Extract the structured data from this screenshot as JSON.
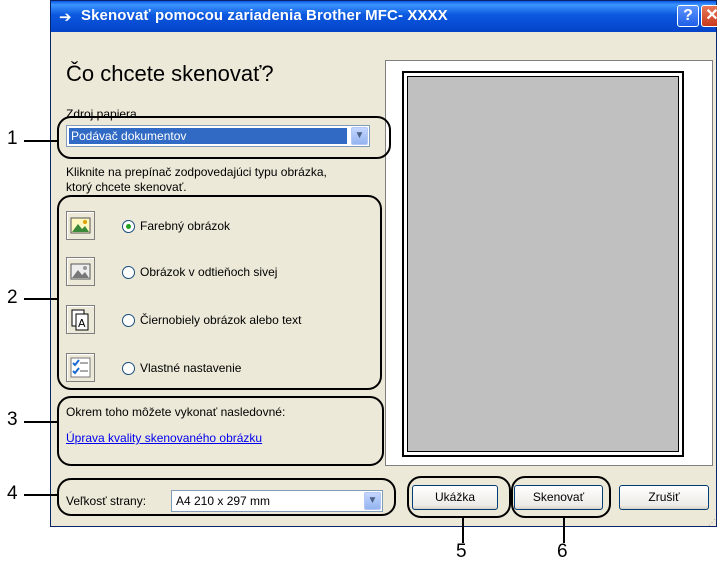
{
  "window": {
    "title": "Skenovať pomocou zariadenia Brother MFC- XXXX",
    "help_label": "?",
    "close_label": "✕"
  },
  "heading": "Čo chcete skenovať?",
  "paper_source": {
    "label": "Zdroj papiera",
    "value": "Podávač dokumentov"
  },
  "instructions": {
    "line1": "Kliknite na prepínač zodpovedajúci typu obrázka,",
    "line2": "ktorý chcete skenovať."
  },
  "scan_types": [
    {
      "label": "Farebný obrázok",
      "icon": "color-photo-icon",
      "selected": true
    },
    {
      "label": "Obrázok v odtieňoch sivej",
      "icon": "grayscale-photo-icon",
      "selected": false
    },
    {
      "label": "Čiernobiely obrázok alebo text",
      "icon": "bw-text-icon",
      "selected": false
    },
    {
      "label": "Vlastné nastavenie",
      "icon": "custom-settings-icon",
      "selected": false
    }
  ],
  "additional": {
    "text": "Okrem toho môžete vykonať nasledovné:",
    "link": "Úprava kvality skenovaného obrázku"
  },
  "page_size": {
    "label": "Veľkosť strany:",
    "value": "A4 210 x 297 mm"
  },
  "buttons": {
    "preview": "Ukážka",
    "scan": "Skenovať",
    "cancel": "Zrušiť"
  },
  "callouts": [
    "1",
    "2",
    "3",
    "4",
    "5",
    "6"
  ],
  "colors": {
    "titlebar": "#0a58e8",
    "dialog_bg": "#ece9d8",
    "selection": "#316ac5",
    "preview_area": "#c0c0c0",
    "link": "#0000ee"
  }
}
